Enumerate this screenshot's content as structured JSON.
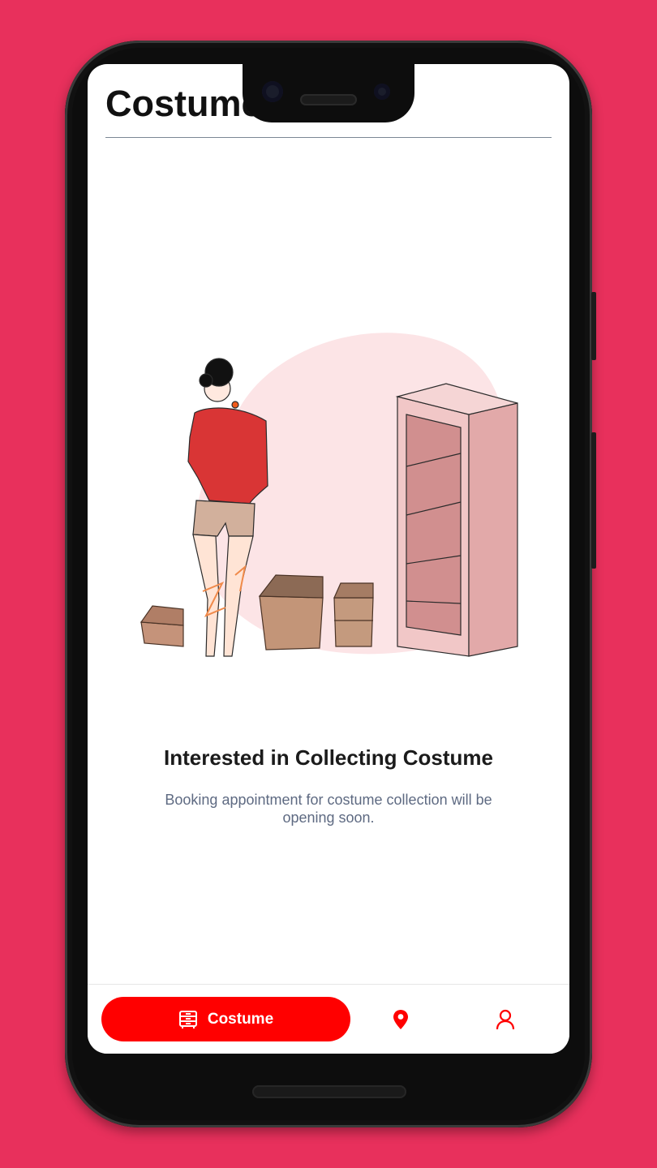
{
  "header": {
    "title": "Costume"
  },
  "empty_state": {
    "title": "Interested in Collecting Costume",
    "description": "Booking appointment for costume collection will be opening soon."
  },
  "bottom_nav": {
    "active_label": "Costume",
    "items": [
      {
        "icon": "wardrobe-icon",
        "label": "Costume",
        "active": true
      },
      {
        "icon": "location-pin-icon",
        "active": false
      },
      {
        "icon": "profile-icon",
        "active": false
      }
    ]
  },
  "colors": {
    "background": "#e8305c",
    "accent": "#ff0000",
    "blob": "#fce4e6",
    "shelf": "#e2a9a9"
  }
}
